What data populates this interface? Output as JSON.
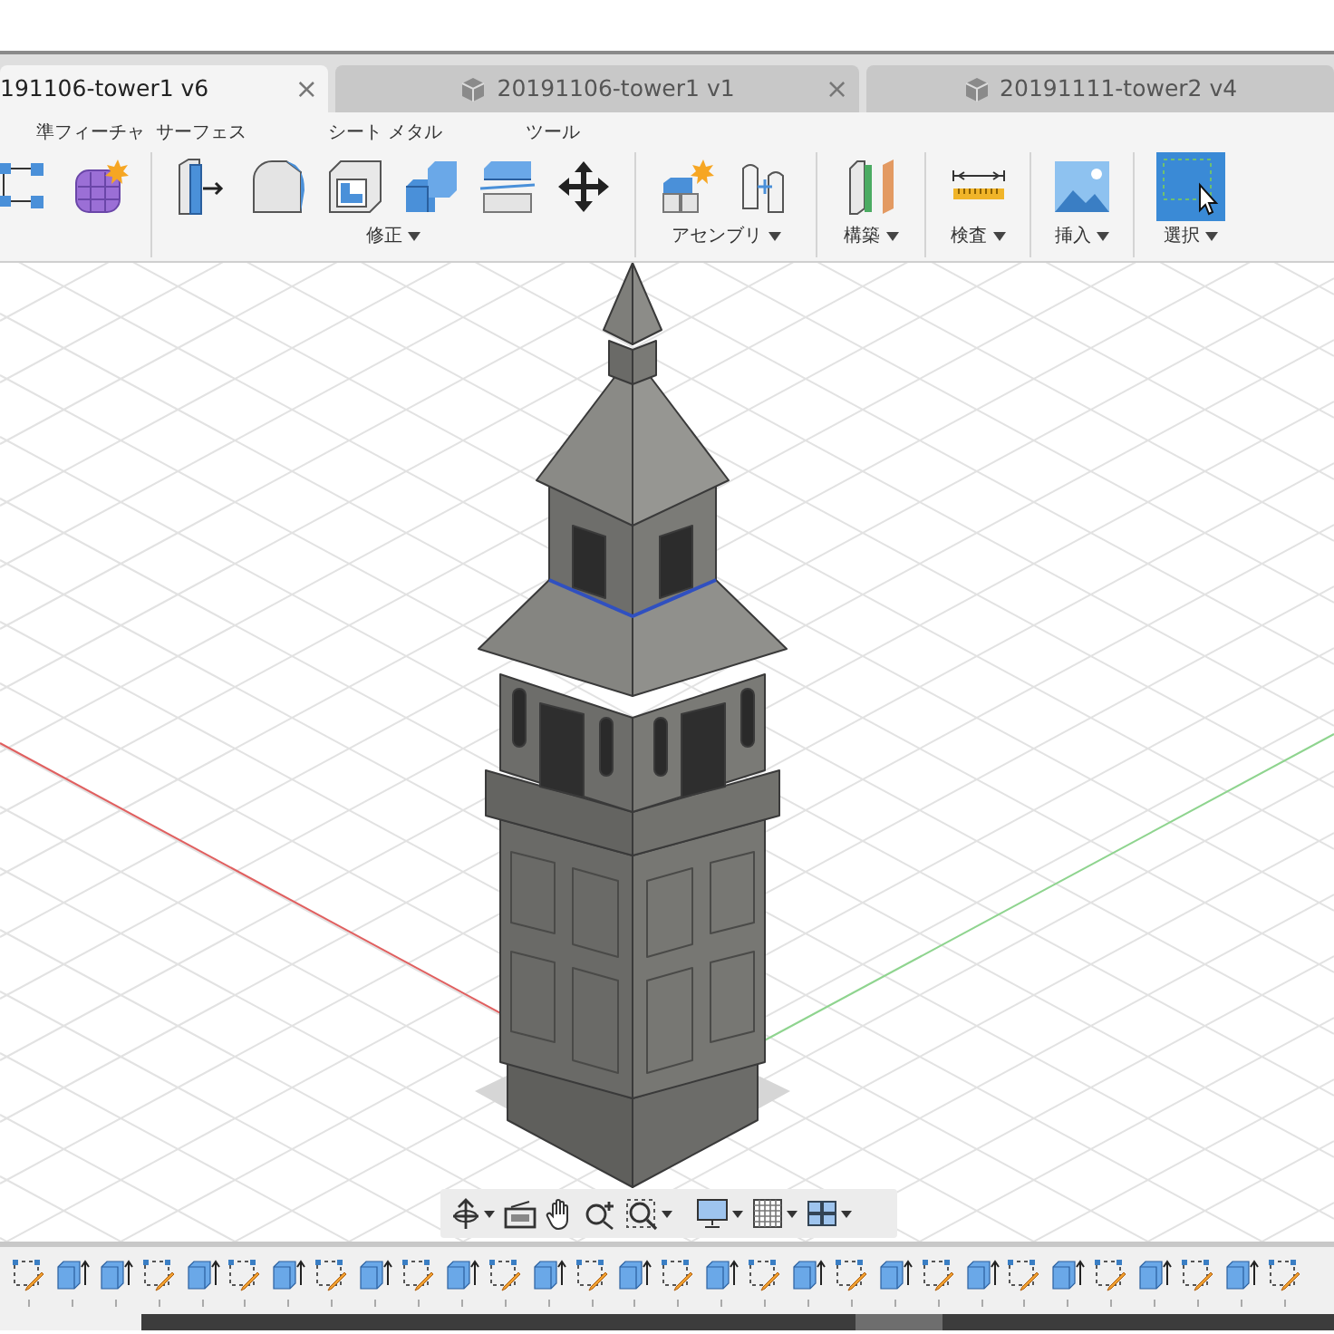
{
  "tabs": [
    {
      "label": "191106-tower1 v6",
      "selected": true,
      "close": "×"
    },
    {
      "label": "20191106-tower1 v1",
      "selected": false,
      "close": "×"
    },
    {
      "label": "20191111-tower2 v4",
      "selected": false
    }
  ],
  "workspace_tabs": [
    "準フィーチャ",
    "サーフェス",
    "シート メタル",
    "ツール"
  ],
  "ribbon_groups": [
    {
      "label": "修正"
    },
    {
      "label": "アセンブリ"
    },
    {
      "label": "構築"
    },
    {
      "label": "検査"
    },
    {
      "label": "挿入"
    },
    {
      "label": "選択"
    }
  ],
  "timeline": [
    {
      "kind": "sketch"
    },
    {
      "kind": "extrude"
    },
    {
      "kind": "extrude"
    },
    {
      "kind": "sketch"
    },
    {
      "kind": "extrude"
    },
    {
      "kind": "sketch"
    },
    {
      "kind": "extrude"
    },
    {
      "kind": "sketch"
    },
    {
      "kind": "extrude"
    },
    {
      "kind": "sketch"
    },
    {
      "kind": "extrude"
    },
    {
      "kind": "sketch"
    },
    {
      "kind": "extrude"
    },
    {
      "kind": "sketch"
    },
    {
      "kind": "extrude"
    },
    {
      "kind": "sketch"
    },
    {
      "kind": "extrude"
    },
    {
      "kind": "sketch"
    },
    {
      "kind": "extrude"
    },
    {
      "kind": "sketch"
    },
    {
      "kind": "extrude"
    },
    {
      "kind": "sketch"
    },
    {
      "kind": "extrude"
    },
    {
      "kind": "sketch"
    },
    {
      "kind": "extrude"
    },
    {
      "kind": "sketch"
    },
    {
      "kind": "extrude"
    },
    {
      "kind": "sketch"
    },
    {
      "kind": "extrude"
    },
    {
      "kind": "sketch"
    }
  ]
}
